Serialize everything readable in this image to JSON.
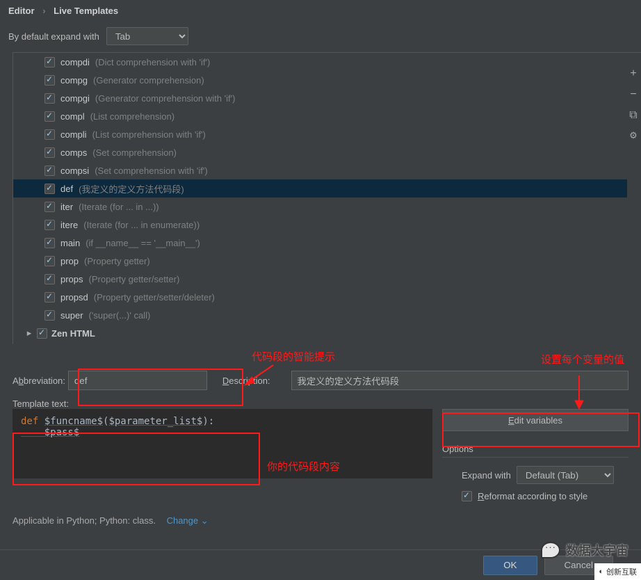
{
  "breadcrumb": {
    "a": "Editor",
    "b": "Live Templates"
  },
  "expand_label": "By default expand with",
  "expand_value": "Tab",
  "items": [
    {
      "name": "compdi",
      "desc": "(Dict comprehension with 'if')"
    },
    {
      "name": "compg",
      "desc": "(Generator comprehension)"
    },
    {
      "name": "compgi",
      "desc": "(Generator comprehension with 'if')"
    },
    {
      "name": "compl",
      "desc": "(List comprehension)"
    },
    {
      "name": "compli",
      "desc": "(List comprehension with 'if')"
    },
    {
      "name": "comps",
      "desc": "(Set comprehension)"
    },
    {
      "name": "compsi",
      "desc": "(Set comprehension with 'if')"
    },
    {
      "name": "def",
      "desc": "(我定义的定义方法代码段)"
    },
    {
      "name": "iter",
      "desc": "(Iterate (for ... in ...))"
    },
    {
      "name": "itere",
      "desc": "(Iterate (for ... in enumerate))"
    },
    {
      "name": "main",
      "desc": "(if __name__ == '__main__')"
    },
    {
      "name": "prop",
      "desc": "(Property getter)"
    },
    {
      "name": "props",
      "desc": "(Property getter/setter)"
    },
    {
      "name": "propsd",
      "desc": "(Property getter/setter/deleter)"
    },
    {
      "name": "super",
      "desc": "('super(...)' call)"
    }
  ],
  "selected_index": 7,
  "group": "Zen HTML",
  "anno1": "代码段的智能提示",
  "anno2": "设置每个变量的值",
  "anno3": "你的代码段内容",
  "abbr_label_pre": "A",
  "abbr_label_ul": "b",
  "abbr_label_post": "breviation:",
  "abbr_value": "def",
  "desc_label_ul": "D",
  "desc_label_post": "escription:",
  "desc_value": "我定义的定义方法代码段",
  "tmpl_label_ul": "T",
  "tmpl_label_post": "emplate text:",
  "code_kw": "def ",
  "code_func": "$funcname$",
  "code_paren_open": "(",
  "code_param": "$parameter_list$",
  "code_paren_close": "):",
  "code_line2": "    $pass$",
  "editvars_pre": "",
  "editvars_ul": "E",
  "editvars_post": "dit variables",
  "options_label": "Options",
  "expandwith_label": "Expand with",
  "expandwith_value": "Default (Tab)",
  "reformat_pre": "",
  "reformat_ul": "R",
  "reformat_post": "eformat according to style",
  "applicable": "Applicable in Python; Python: class.",
  "change": "Change",
  "ok": "OK",
  "cancel": "Cancel",
  "watermark": "数据大宇宙",
  "watermark2": "创新互联"
}
